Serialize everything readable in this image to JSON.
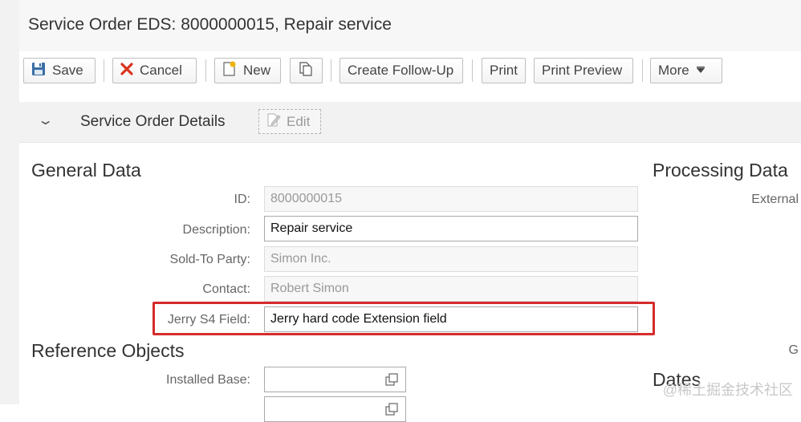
{
  "title": "Service Order EDS: 8000000015, Repair service",
  "toolbar": {
    "save": "Save",
    "cancel": "Cancel",
    "new": "New",
    "create_follow_up": "Create Follow-Up",
    "print": "Print",
    "print_preview": "Print Preview",
    "more": "More"
  },
  "section": {
    "title": "Service Order Details",
    "edit": "Edit"
  },
  "general_data": {
    "heading": "General Data",
    "fields": {
      "id": {
        "label": "ID:",
        "value": "8000000015"
      },
      "description": {
        "label": "Description:",
        "value": "Repair service"
      },
      "sold_to": {
        "label": "Sold-To Party:",
        "value": "Simon Inc."
      },
      "contact": {
        "label": "Contact:",
        "value": "Robert Simon"
      },
      "jerry": {
        "label": "Jerry S4 Field:",
        "value": "Jerry hard code Extension field"
      }
    }
  },
  "reference_objects": {
    "heading": "Reference Objects",
    "installed_base_label": "Installed Base:",
    "installed_base_value": ""
  },
  "processing_data": {
    "heading": "Processing Data",
    "external_label": "External",
    "g_label": "G"
  },
  "dates": {
    "heading": "Dates"
  },
  "watermark": "@稀土掘金技术社区",
  "colors": {
    "highlight": "#d52b2b",
    "cancel_x": "#d9331f",
    "save_icon": "#3a6ea5"
  }
}
